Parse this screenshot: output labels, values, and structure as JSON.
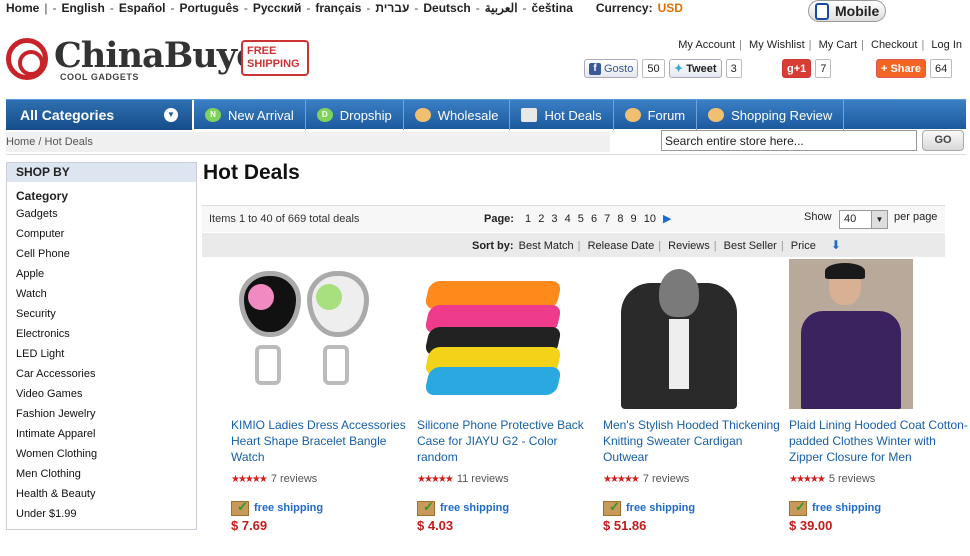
{
  "langbar": {
    "items": [
      "Home",
      "English",
      "Español",
      "Português",
      "Русский",
      "français",
      "עברית",
      "Deutsch",
      "العربية",
      "čeština"
    ],
    "currency_label": "Currency:",
    "currency_value": "USD"
  },
  "mobile_button": "Mobile",
  "logo": {
    "name": "ChinaBuye",
    "tagline": "COOL GADGETS",
    "badge": "FREE SHIPPING"
  },
  "account_links": [
    "My Account",
    "My Wishlist",
    "My Cart",
    "Checkout",
    "Log In"
  ],
  "social": {
    "facebook_label": "Gosto",
    "facebook_count": "50",
    "twitter_label": "Tweet",
    "twitter_count": "3",
    "gplus_label": "+1",
    "gplus_count": "7",
    "share_label": "Share",
    "share_count": "64"
  },
  "nav": {
    "all_categories": "All Categories",
    "items": [
      "New Arrival",
      "Dropship",
      "Wholesale",
      "Hot Deals",
      "Forum",
      "Shopping Review"
    ]
  },
  "breadcrumb": {
    "home": "Home",
    "sep": "/",
    "current": "Hot Deals"
  },
  "search": {
    "value": "Search entire store here...",
    "go": "GO"
  },
  "sidebar": {
    "title": "SHOP BY",
    "category_title": "Category",
    "categories": [
      "Gadgets",
      "Computer",
      "Cell Phone",
      "Apple",
      "Watch",
      "Security",
      "Electronics",
      "LED Light",
      "Car Accessories",
      "Video Games",
      "Fashion Jewelry",
      "Intimate Apparel",
      "Women Clothing",
      "Men Clothing",
      "Health & Beauty",
      "Under $1.99"
    ]
  },
  "page_title": "Hot Deals",
  "pager": {
    "items_text": "Items 1 to 40 of 669 total deals",
    "page_label": "Page:",
    "pages": [
      "1",
      "2",
      "3",
      "4",
      "5",
      "6",
      "7",
      "8",
      "9",
      "10"
    ],
    "show_label": "Show",
    "per_page": "40",
    "per_page_label": "per page"
  },
  "sort": {
    "label": "Sort by:",
    "options": [
      "Best Match",
      "Release Date",
      "Reviews",
      "Best Seller",
      "Price"
    ]
  },
  "products": [
    {
      "title": "KIMIO Ladies Dress Accessories Heart Shape Bracelet Bangle Watch",
      "reviews": "7 reviews",
      "shipping": "free shipping",
      "price": "$ 7.69"
    },
    {
      "title": "Silicone Phone Protective Back Case for JIAYU G2 - Color random",
      "reviews": "11 reviews",
      "shipping": "free shipping",
      "price": "$ 4.03"
    },
    {
      "title": "Men's Stylish Hooded Thickening Knitting Sweater Cardigan Outwear",
      "reviews": "7 reviews",
      "shipping": "free shipping",
      "price": "$ 51.86"
    },
    {
      "title": "Plaid Lining Hooded Coat Cotton-padded Clothes Winter with Zipper Closure for Men",
      "reviews": "5 reviews",
      "shipping": "free shipping",
      "price": "$ 39.00"
    }
  ],
  "colors": {
    "accent": "#1c5a9e",
    "price": "#c21b1b",
    "link": "#1560a8"
  }
}
